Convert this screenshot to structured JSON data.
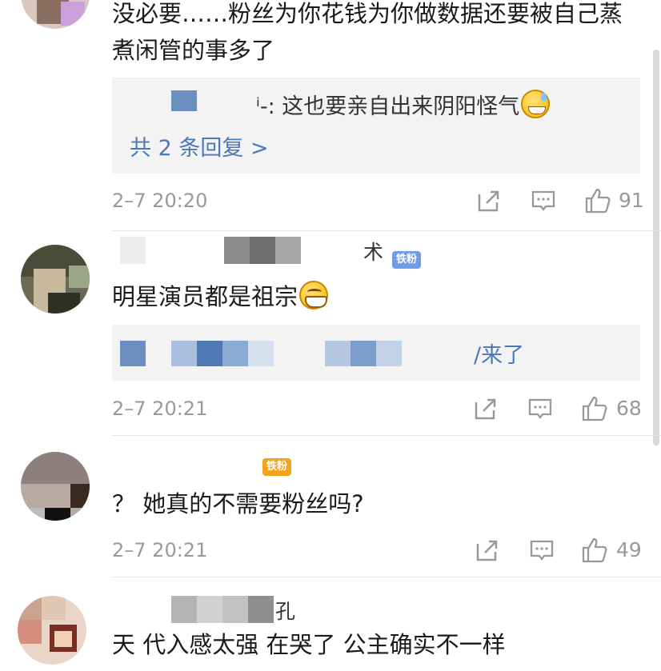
{
  "comments": [
    {
      "text_line1": "没必要……粉丝为你花钱为你做数据还要被自己蒸",
      "text_line2": "煮闲管的事多了",
      "reply_text": "ⁱ-: 这也要亲自出来阴阳怪气",
      "reply_emoji": "grinning-sweat-emoji",
      "reply_more": "共 2 条回复 >",
      "time": "2–7 20:20",
      "likes": "91"
    },
    {
      "username_tail": "术",
      "badge": "铁粉",
      "text": "明星演员都是祖宗",
      "text_emoji": "grinning-emoji",
      "reply_text": "/来了",
      "time": "2–7 20:21",
      "likes": "68"
    },
    {
      "badge": "铁粉",
      "text": "？ 她真的不需要粉丝吗?",
      "time": "2–7 20:21",
      "likes": "49"
    },
    {
      "username_tail": "孔",
      "text": "天 代入感太强 在哭了 公主确实不一样"
    }
  ],
  "icons": {
    "share": "share-icon",
    "comment": "comment-icon",
    "like": "thumbs-up-icon"
  },
  "colors": {
    "link": "#4a78b8",
    "meta": "#999999",
    "badge_blue": "#6e9ce8",
    "badge_orange": "#f4a21c"
  }
}
